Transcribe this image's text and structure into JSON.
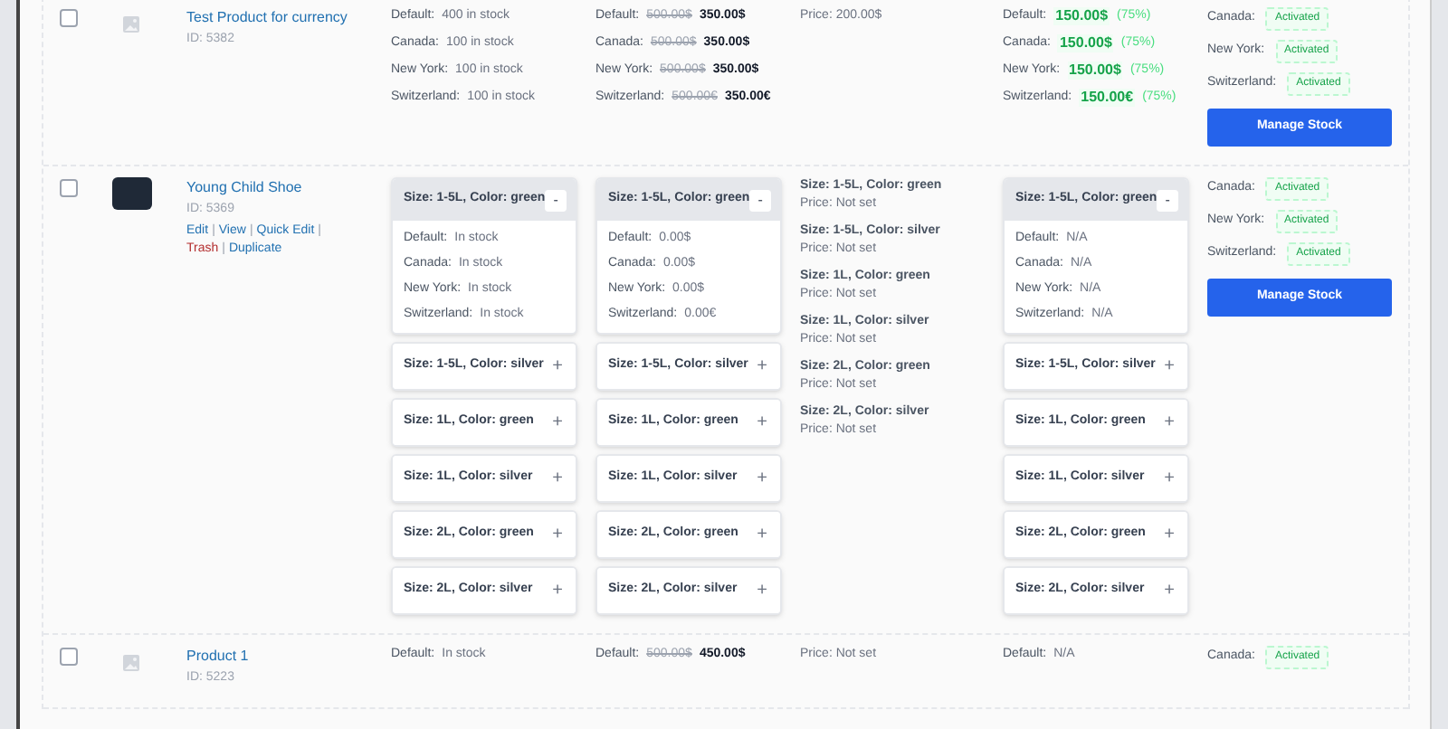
{
  "rows": [
    {
      "checked": false,
      "thumbnail": {
        "kind": "placeholder"
      },
      "name": "Test Product for currency",
      "id": "ID: 5382",
      "stock": {
        "kind": "lines",
        "lines": [
          {
            "label": "Default:",
            "value": "400 in stock"
          },
          {
            "label": "Canada:",
            "value": "100 in stock"
          },
          {
            "label": "New York:",
            "value": "100 in stock"
          },
          {
            "label": "Switzerland:",
            "value": "100 in stock"
          }
        ]
      },
      "price": {
        "kind": "lines",
        "lines": [
          {
            "label": "Default:",
            "old": "500.00$",
            "value": "350.00$"
          },
          {
            "label": "Canada:",
            "old": "500.00$",
            "value": "350.00$"
          },
          {
            "label": "New York:",
            "old": "500.00$",
            "value": "350.00$"
          },
          {
            "label": "Switzerland:",
            "old": "500.00€",
            "value": "350.00€"
          }
        ]
      },
      "regular_price": {
        "kind": "text",
        "text": "Price: 200.00$"
      },
      "sale_price": {
        "kind": "lines",
        "lines": [
          {
            "label": "Default:",
            "value": "150.00$",
            "note": "(75%)"
          },
          {
            "label": "Canada:",
            "value": "150.00$",
            "note": "(75%)"
          },
          {
            "label": "New York:",
            "value": "150.00$",
            "note": "(75%)"
          },
          {
            "label": "Switzerland:",
            "value": "150.00€",
            "note": "(75%)"
          }
        ]
      },
      "availability": [
        {
          "label": "Canada:",
          "badge": "Activated"
        },
        {
          "label": "New York:",
          "badge": "Activated"
        },
        {
          "label": "Switzerland:",
          "badge": "Activated"
        }
      ],
      "button": "Manage Stock"
    },
    {
      "checked": false,
      "thumbnail": {
        "kind": "photo"
      },
      "name": "Young Child Shoe",
      "id": "ID: 5369",
      "actions": {
        "separator": "|",
        "links": [
          {
            "label": "Edit",
            "kind": "normal"
          },
          {
            "label": "View",
            "kind": "normal"
          },
          {
            "label": "Quick Edit",
            "kind": "normal"
          },
          {
            "label": "Trash",
            "kind": "danger"
          },
          {
            "label": "Duplicate",
            "kind": "normal"
          }
        ]
      },
      "stock": {
        "kind": "variations",
        "variations": [
          {
            "title": "Size: 1-5L, Color: green",
            "expanded": true,
            "toggle": "-",
            "lines": [
              {
                "label": "Default:",
                "value": "In stock"
              },
              {
                "label": "Canada:",
                "value": "In stock"
              },
              {
                "label": "New York:",
                "value": "In stock"
              },
              {
                "label": "Switzerland:",
                "value": "In stock"
              }
            ]
          },
          {
            "title": "Size: 1-5L, Color: silver",
            "expanded": false,
            "toggle": "+"
          },
          {
            "title": "Size: 1L, Color: green",
            "expanded": false,
            "toggle": "+"
          },
          {
            "title": "Size: 1L, Color: silver",
            "expanded": false,
            "toggle": "+"
          },
          {
            "title": "Size: 2L, Color: green",
            "expanded": false,
            "toggle": "+"
          },
          {
            "title": "Size: 2L, Color: silver",
            "expanded": false,
            "toggle": "+"
          }
        ]
      },
      "price": {
        "kind": "variations",
        "variations": [
          {
            "title": "Size: 1-5L, Color: green",
            "expanded": true,
            "toggle": "-",
            "lines": [
              {
                "label": "Default:",
                "value": "0.00$"
              },
              {
                "label": "Canada:",
                "value": "0.00$"
              },
              {
                "label": "New York:",
                "value": "0.00$"
              },
              {
                "label": "Switzerland:",
                "value": "0.00€"
              }
            ]
          },
          {
            "title": "Size: 1-5L, Color: silver",
            "expanded": false,
            "toggle": "+"
          },
          {
            "title": "Size: 1L, Color: green",
            "expanded": false,
            "toggle": "+"
          },
          {
            "title": "Size: 1L, Color: silver",
            "expanded": false,
            "toggle": "+"
          },
          {
            "title": "Size: 2L, Color: green",
            "expanded": false,
            "toggle": "+"
          },
          {
            "title": "Size: 2L, Color: silver",
            "expanded": false,
            "toggle": "+"
          }
        ]
      },
      "regular_price": {
        "kind": "variation_prices",
        "items": [
          {
            "title": "Size: 1-5L, Color: green",
            "price": "Price: Not set"
          },
          {
            "title": "Size: 1-5L, Color: silver",
            "price": "Price: Not set"
          },
          {
            "title": "Size: 1L, Color: green",
            "price": "Price: Not set"
          },
          {
            "title": "Size: 1L, Color: silver",
            "price": "Price: Not set"
          },
          {
            "title": "Size: 2L, Color: green",
            "price": "Price: Not set"
          },
          {
            "title": "Size: 2L, Color: silver",
            "price": "Price: Not set"
          }
        ]
      },
      "sale_price": {
        "kind": "variations",
        "variations": [
          {
            "title": "Size: 1-5L, Color: green",
            "expanded": true,
            "toggle": "-",
            "lines": [
              {
                "label": "Default:",
                "value": "N/A"
              },
              {
                "label": "Canada:",
                "value": "N/A"
              },
              {
                "label": "New York:",
                "value": "N/A"
              },
              {
                "label": "Switzerland:",
                "value": "N/A"
              }
            ]
          },
          {
            "title": "Size: 1-5L, Color: silver",
            "expanded": false,
            "toggle": "+"
          },
          {
            "title": "Size: 1L, Color: green",
            "expanded": false,
            "toggle": "+"
          },
          {
            "title": "Size: 1L, Color: silver",
            "expanded": false,
            "toggle": "+"
          },
          {
            "title": "Size: 2L, Color: green",
            "expanded": false,
            "toggle": "+"
          },
          {
            "title": "Size: 2L, Color: silver",
            "expanded": false,
            "toggle": "+"
          }
        ]
      },
      "availability": [
        {
          "label": "Canada:",
          "badge": "Activated"
        },
        {
          "label": "New York:",
          "badge": "Activated"
        },
        {
          "label": "Switzerland:",
          "badge": "Activated"
        }
      ],
      "button": "Manage Stock"
    },
    {
      "checked": false,
      "thumbnail": {
        "kind": "placeholder"
      },
      "name": "Product 1",
      "id": "ID: 5223",
      "stock": {
        "kind": "lines",
        "lines": [
          {
            "label": "Default:",
            "value": "In stock"
          }
        ]
      },
      "price": {
        "kind": "lines",
        "lines": [
          {
            "label": "Default:",
            "old": "500.00$",
            "value": "450.00$"
          }
        ]
      },
      "regular_price": {
        "kind": "text",
        "text": "Price: Not set"
      },
      "sale_price": {
        "kind": "lines",
        "lines": [
          {
            "label": "Default:",
            "value": "N/A"
          }
        ]
      },
      "availability": [
        {
          "label": "Canada:",
          "badge": "Activated"
        }
      ]
    }
  ]
}
